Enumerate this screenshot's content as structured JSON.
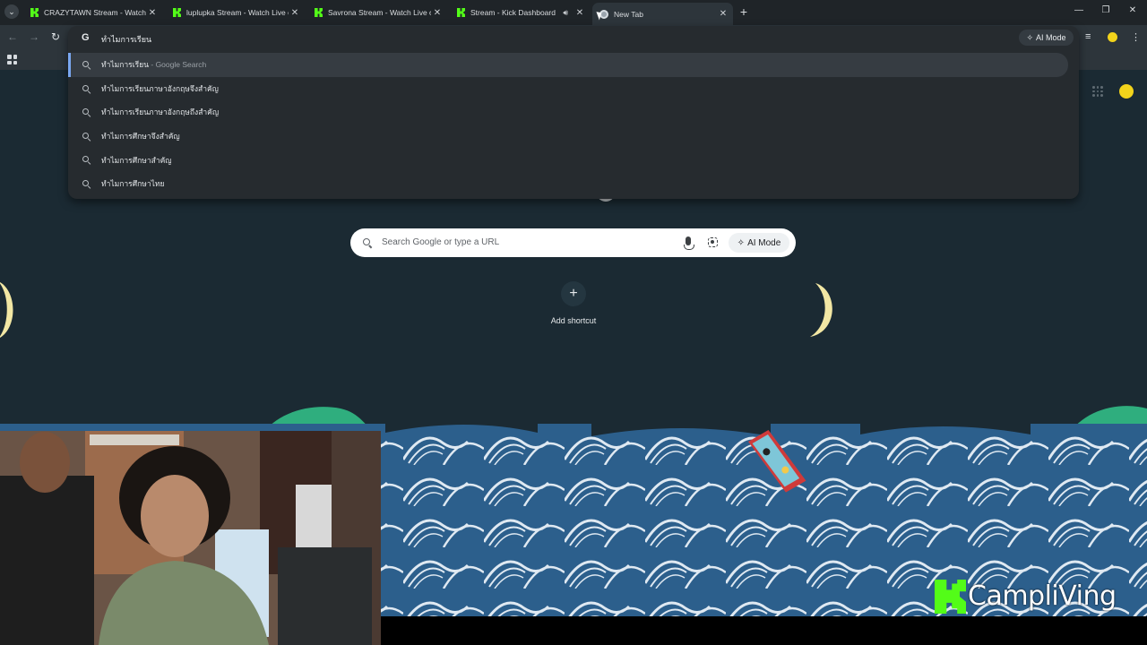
{
  "browser": {
    "tabs": [
      {
        "title": "CRAZYTAWN Stream - Watch Li",
        "favicon": "kick-icon",
        "active": false
      },
      {
        "title": "luplupka Stream - Watch Live o",
        "favicon": "kick-icon",
        "active": false
      },
      {
        "title": "Savrona Stream - Watch Live o",
        "favicon": "kick-icon",
        "active": false
      },
      {
        "title": "Stream - Kick Dashboard",
        "favicon": "kick-icon",
        "active": false,
        "audio": true
      },
      {
        "title": "New Tab",
        "favicon": "chrome-icon",
        "active": true
      }
    ],
    "omnibox": {
      "query": "ทำไมการเรียน",
      "ai_mode_label": "AI Mode",
      "suggestions": [
        {
          "text": "ทำไมการเรียน",
          "hint": " - Google Search",
          "selected": true
        },
        {
          "text": "ทำไมการเรียนภาษาอังกฤษจึงสำคัญ",
          "hint": ""
        },
        {
          "text": "ทำไมการเรียนภาษาอังกฤษถึงสำคัญ",
          "hint": ""
        },
        {
          "text": "ทำไมการศึกษาจึงสำคัญ",
          "hint": ""
        },
        {
          "text": "ทำไมการศึกษาสำคัญ",
          "hint": ""
        },
        {
          "text": "ทำไมการศึกษาไทย",
          "hint": ""
        }
      ]
    }
  },
  "ntp": {
    "search_placeholder": "Search Google or type a URL",
    "ai_mode_label": "AI Mode",
    "add_shortcut_label": "Add shortcut"
  },
  "stream_overlay": {
    "channel_name": "CampliVing"
  },
  "colors": {
    "kick_green": "#53fc18",
    "ntp_background": "#1b2a33",
    "tabstrip": "#1f2428",
    "toolbar": "#2d353b"
  }
}
